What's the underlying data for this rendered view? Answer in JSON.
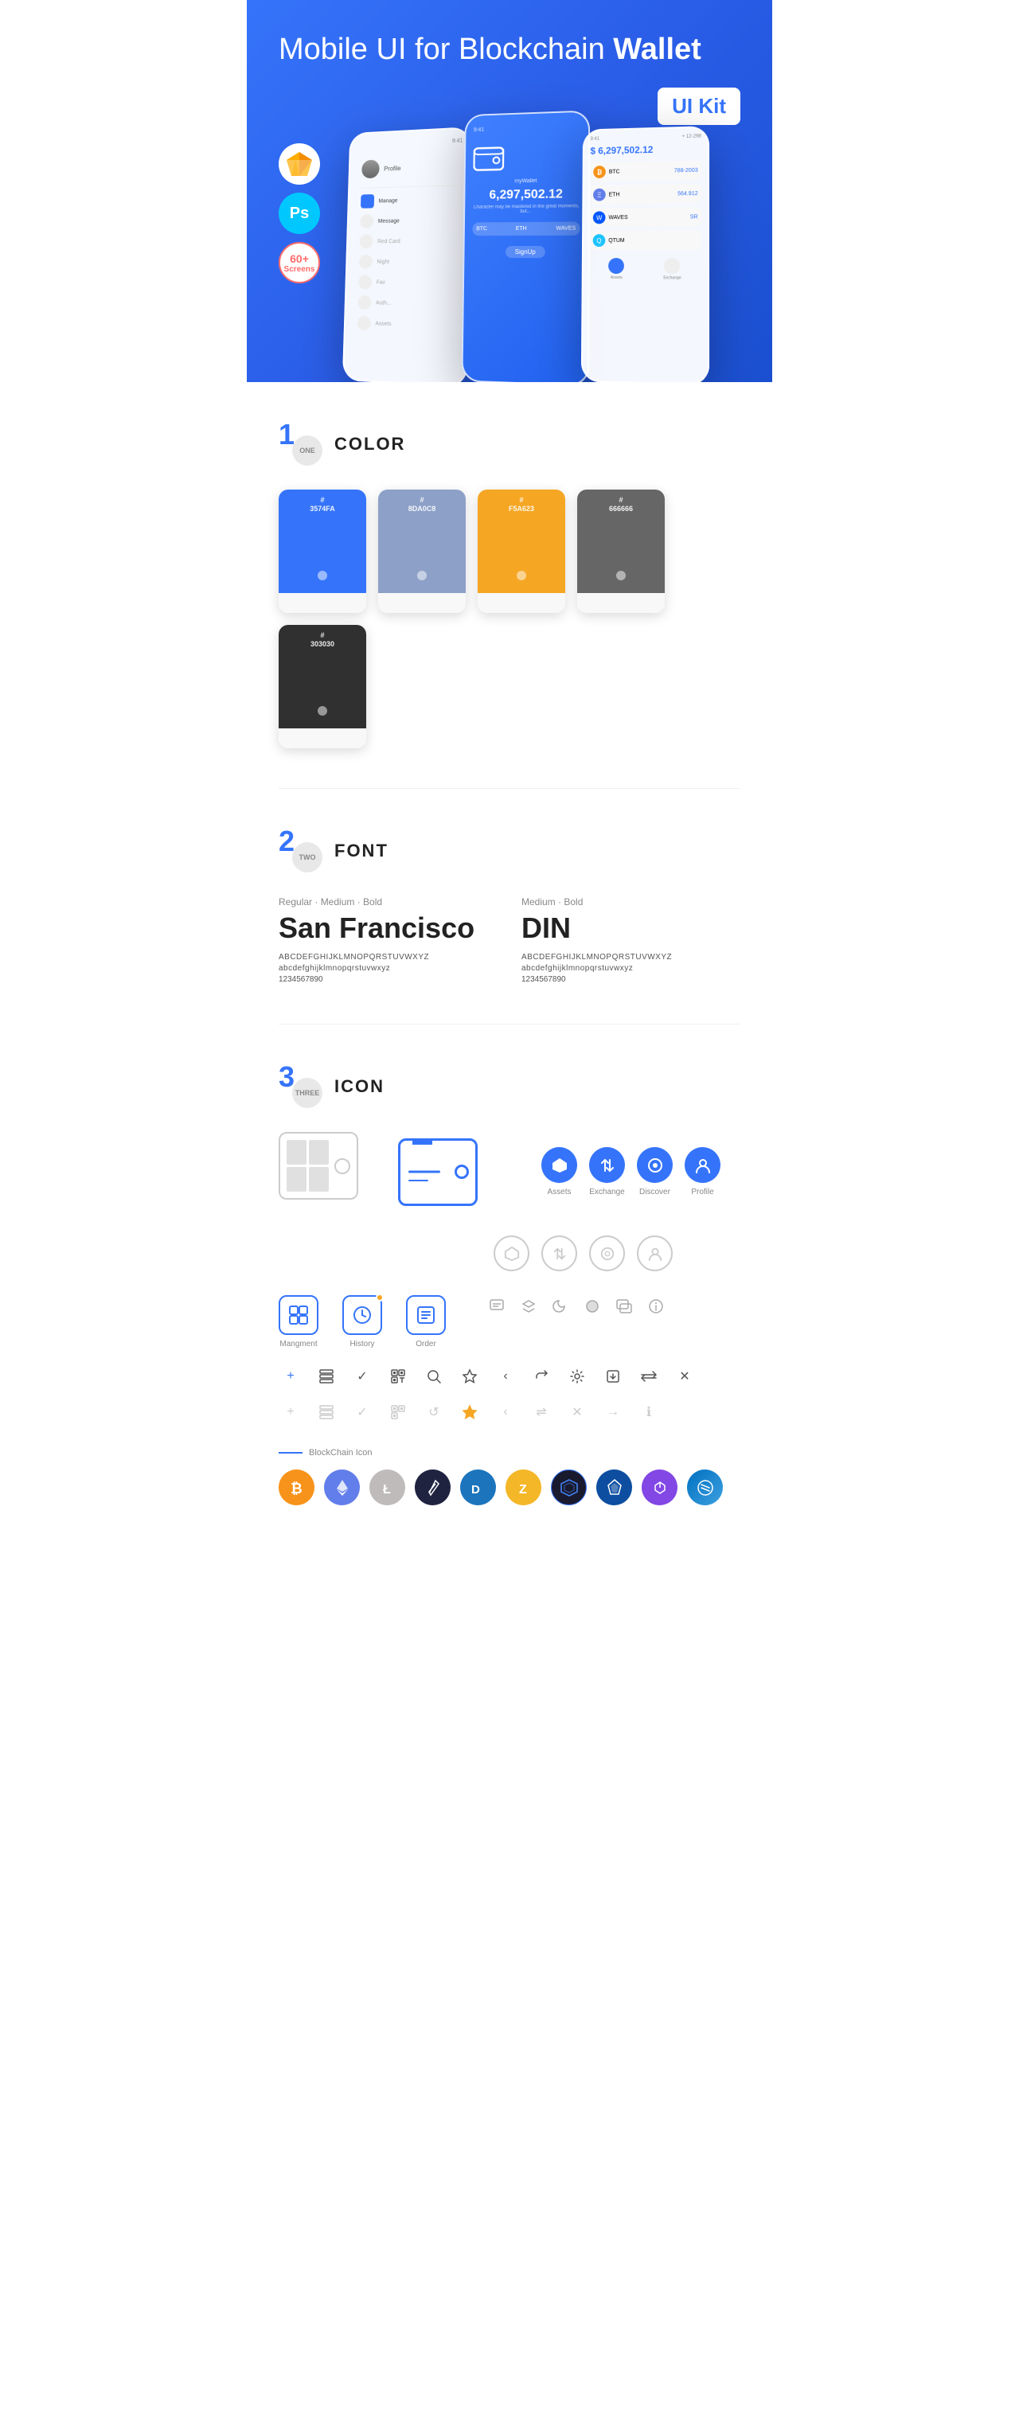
{
  "hero": {
    "title": "Mobile UI for Blockchain ",
    "title_bold": "Wallet",
    "badge": "UI Kit",
    "badge_sketch": "Sketch",
    "badge_ps": "Ps",
    "badge_screens": "60+",
    "badge_screens_label": "Screens"
  },
  "sections": {
    "color": {
      "number": "1",
      "number_text": "ONE",
      "title": "COLOR",
      "swatches": [
        {
          "hex": "#3574FA",
          "label": "#\n3574FA"
        },
        {
          "hex": "#8DA0C8",
          "label": "#\n8DA0C8"
        },
        {
          "hex": "#F5A623",
          "label": "#\nF5A623"
        },
        {
          "hex": "#666666",
          "label": "#\n666666"
        },
        {
          "hex": "#303030",
          "label": "#\n303030"
        }
      ]
    },
    "font": {
      "number": "2",
      "number_text": "TWO",
      "title": "FONT",
      "fonts": [
        {
          "meta": "Regular · Medium · Bold",
          "name": "San Francisco",
          "uppercase": "ABCDEFGHIJKLMNOPQRSTUVWXYZ",
          "lowercase": "abcdefghijklmnopqrstuvwxyz",
          "numbers": "1234567890"
        },
        {
          "meta": "Medium · Bold",
          "name": "DIN",
          "uppercase": "ABCDEFGHIJKLMNOPQRSTUVWXYZ",
          "lowercase": "abcdefghijklmnopqrstuvwxyz",
          "numbers": "1234567890"
        }
      ]
    },
    "icon": {
      "number": "3",
      "number_text": "THREE",
      "title": "ICON",
      "nav_labels": [
        "Assets",
        "Exchange",
        "Discover",
        "Profile"
      ],
      "bottom_labels": [
        "Mangment",
        "History",
        "Order"
      ],
      "blockchain_label": "BlockChain Icon"
    }
  }
}
